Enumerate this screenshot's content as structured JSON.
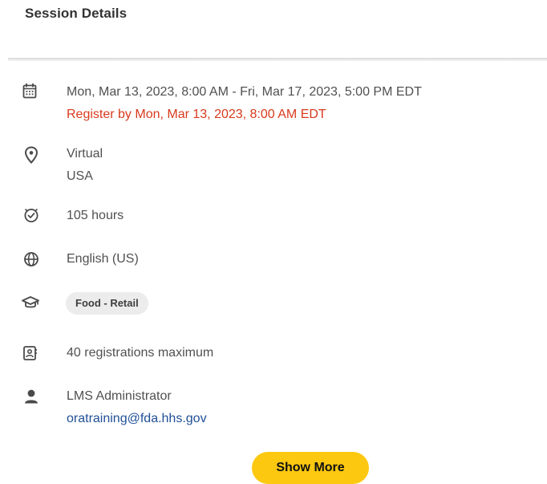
{
  "header": {
    "title": "Session Details"
  },
  "details": {
    "date_range": "Mon, Mar 13, 2023, 8:00 AM - Fri, Mar 17, 2023, 5:00 PM EDT",
    "register_by": "Register by Mon, Mar 13, 2023, 8:00 AM EDT",
    "location_line1": "Virtual",
    "location_line2": "USA",
    "duration": "105 hours",
    "language": "English (US)",
    "category": "Food - Retail",
    "capacity": "40 registrations maximum",
    "contact_name": "LMS Administrator",
    "contact_email": "oratraining@fda.hhs.gov"
  },
  "actions": {
    "show_more_label": "Show More"
  },
  "colors": {
    "accent_button": "#fdc810",
    "register_deadline": "#d83a1c",
    "link": "#1f4f96"
  },
  "icons": {
    "date": "calendar-icon",
    "location": "location-pin-icon",
    "duration": "clock-icon",
    "language": "globe-icon",
    "category": "graduation-cap-icon",
    "capacity": "registration-badge-icon",
    "contact": "person-icon"
  }
}
